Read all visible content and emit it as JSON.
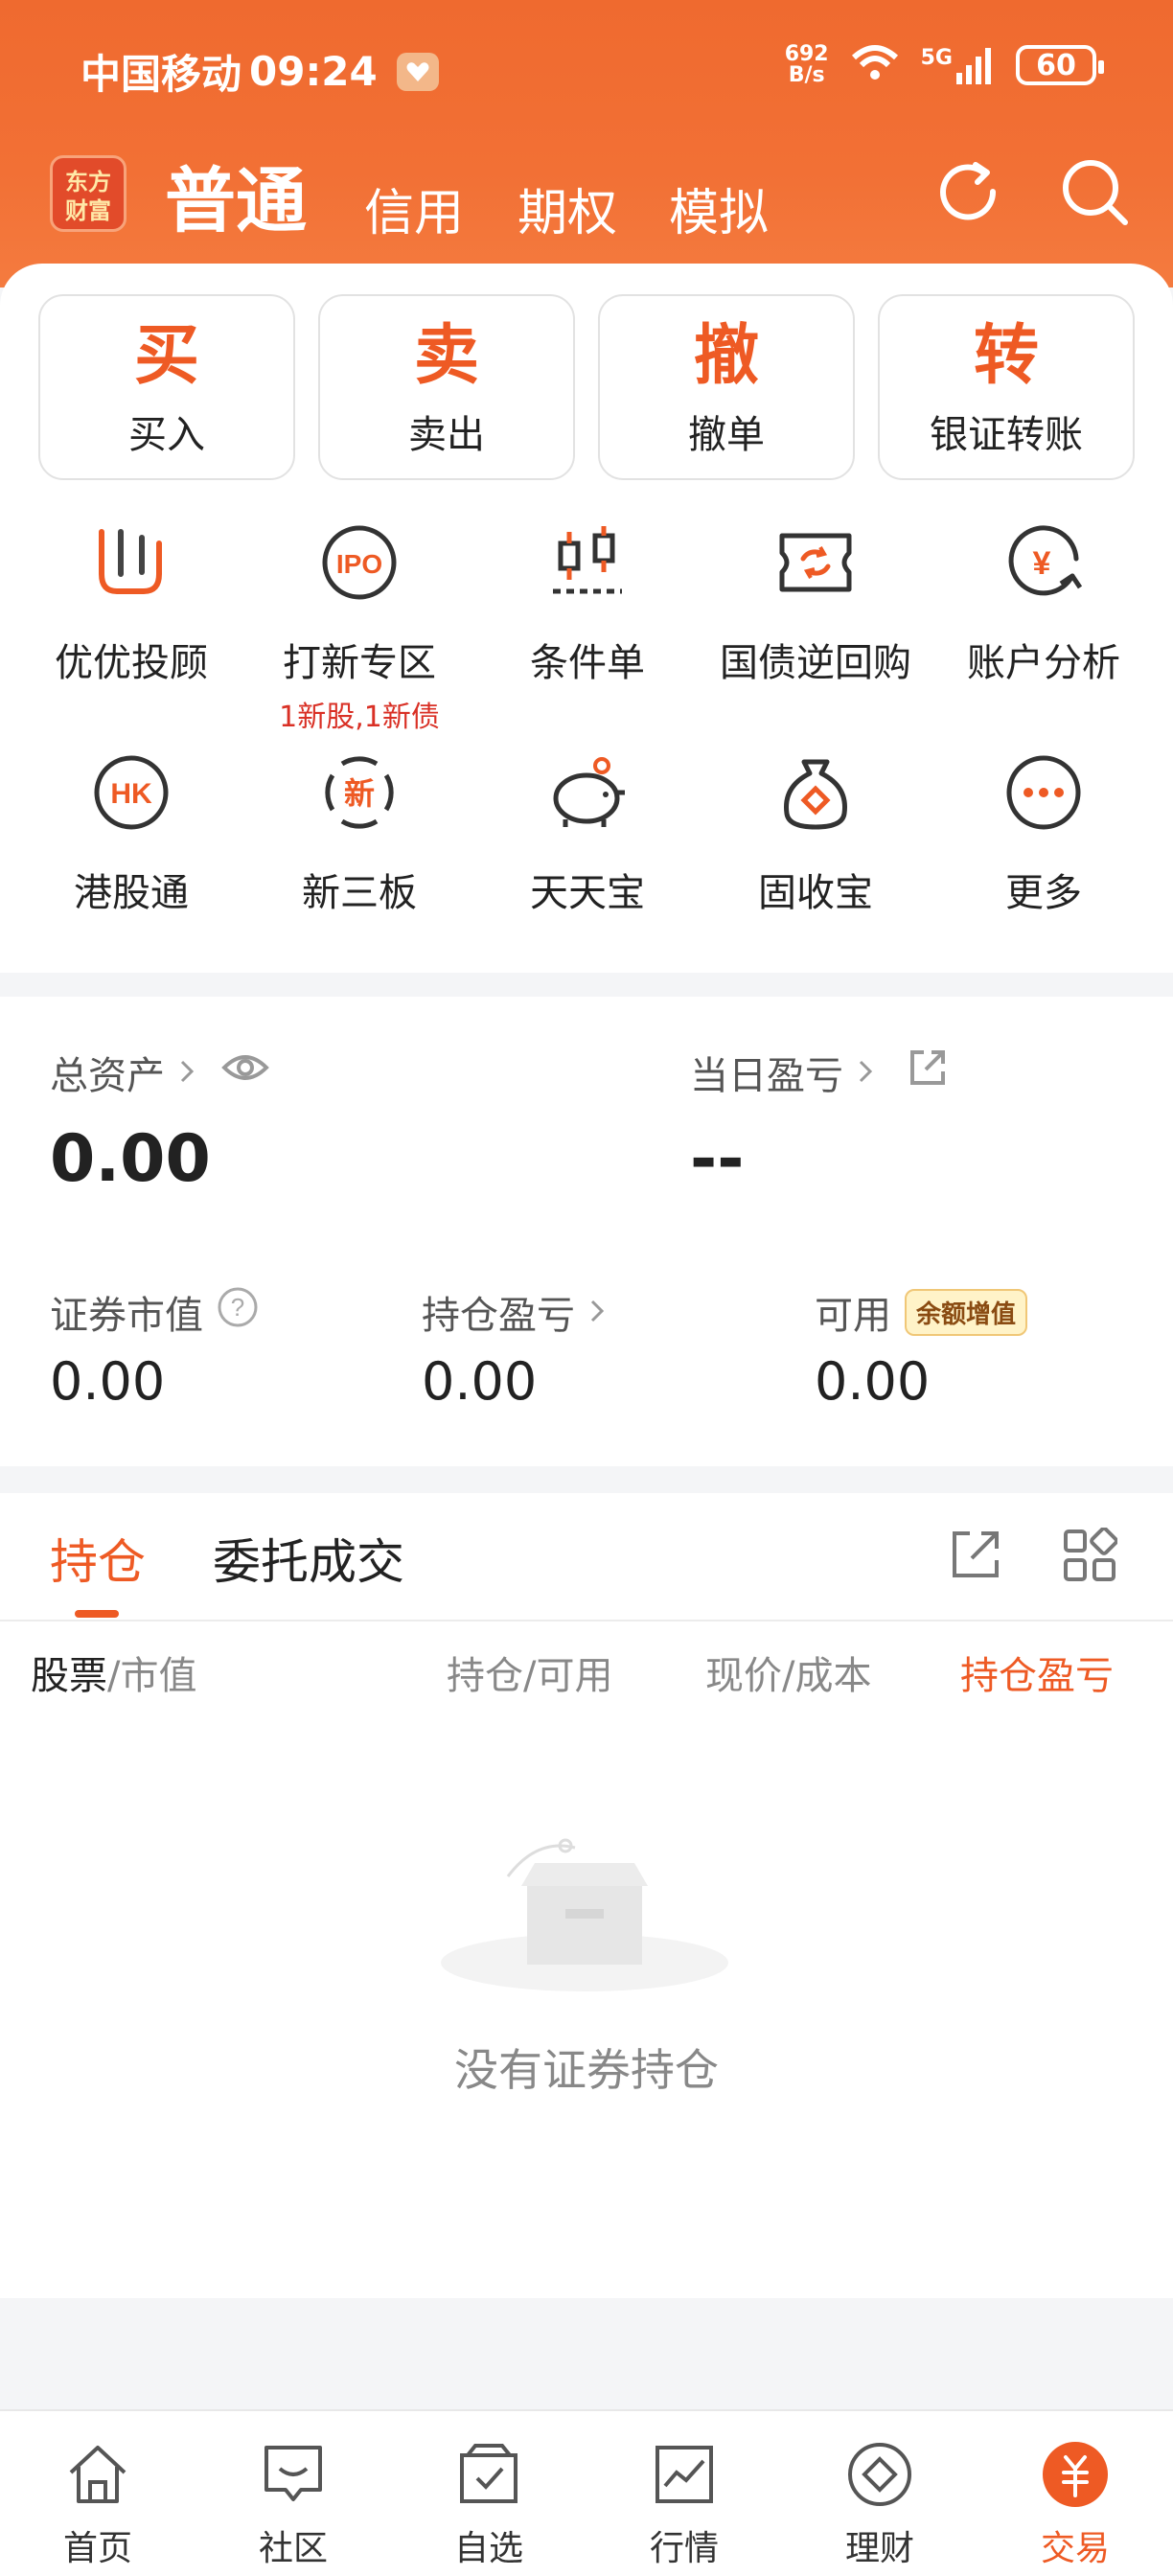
{
  "status_bar": {
    "carrier": "中国移动",
    "time": "09:24",
    "net_speed_value": "692",
    "net_speed_unit": "B/s",
    "signal": "5G",
    "battery": "60"
  },
  "header": {
    "brand_line1": "东方",
    "brand_line2": "财富",
    "tabs": [
      "普通",
      "信用",
      "期权",
      "模拟"
    ],
    "active_tab": "普通"
  },
  "quick_actions": [
    {
      "char": "买",
      "label": "买入"
    },
    {
      "char": "卖",
      "label": "卖出"
    },
    {
      "char": "撤",
      "label": "撤单"
    },
    {
      "char": "转",
      "label": "银证转账"
    }
  ],
  "grid": [
    {
      "label": "优优投顾",
      "icon": "youyou-icon"
    },
    {
      "label": "打新专区",
      "sub": "1新股,1新债",
      "icon": "ipo-icon",
      "icon_text": "IPO"
    },
    {
      "label": "条件单",
      "icon": "condition-order-icon"
    },
    {
      "label": "国债逆回购",
      "icon": "reverse-repo-icon"
    },
    {
      "label": "账户分析",
      "icon": "account-analysis-icon",
      "icon_text": "¥"
    },
    {
      "label": "港股通",
      "icon": "hk-connect-icon",
      "icon_text": "HK"
    },
    {
      "label": "新三板",
      "icon": "neeq-icon",
      "icon_text": "新"
    },
    {
      "label": "天天宝",
      "icon": "piggy-bank-icon"
    },
    {
      "label": "固收宝",
      "icon": "money-bag-icon"
    },
    {
      "label": "更多",
      "icon": "more-icon"
    }
  ],
  "assets": {
    "total_label": "总资产",
    "total_value": "0.00",
    "daily_pl_label": "当日盈亏",
    "daily_pl_value": "--",
    "market_value_label": "证券市值",
    "market_value": "0.00",
    "position_pl_label": "持仓盈亏",
    "position_pl": "0.00",
    "available_label": "可用",
    "available_value": "0.00",
    "yield_badge": "余额增值"
  },
  "positions": {
    "tab_active": "持仓",
    "tab_other": "委托成交",
    "col_stock": "股票",
    "col_stock_sub": "/市值",
    "col_hold": "持仓/可用",
    "col_price": "现价/成本",
    "col_pl": "持仓盈亏",
    "empty_text": "没有证券持仓"
  },
  "bottom_nav": [
    {
      "label": "首页",
      "icon": "home-icon"
    },
    {
      "label": "社区",
      "icon": "community-icon"
    },
    {
      "label": "自选",
      "icon": "watchlist-icon"
    },
    {
      "label": "行情",
      "icon": "market-icon"
    },
    {
      "label": "理财",
      "icon": "wealth-icon"
    },
    {
      "label": "交易",
      "icon": "trade-icon",
      "active": true
    }
  ],
  "colors": {
    "accent": "#ee5a24",
    "header": "#ef6a2f",
    "red": "#d93025"
  }
}
